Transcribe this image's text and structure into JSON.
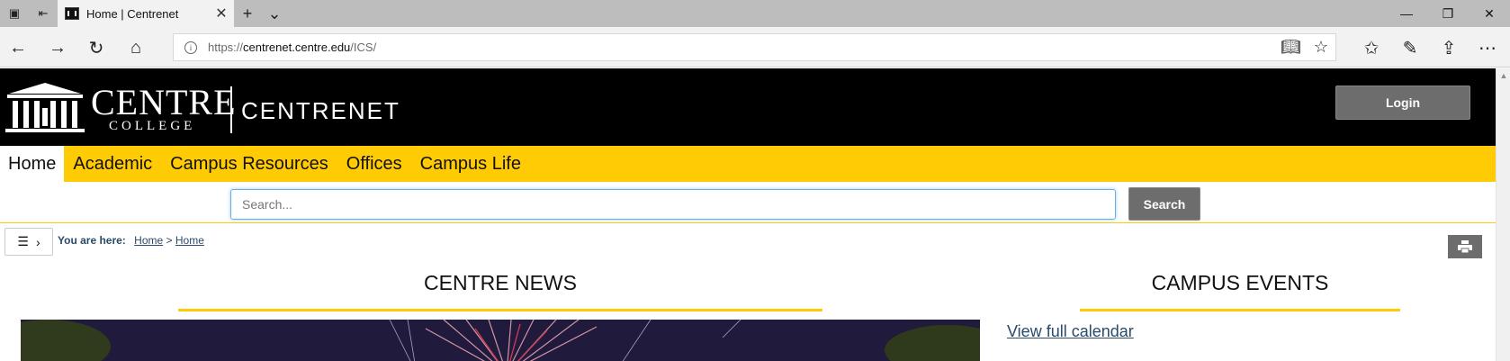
{
  "browser": {
    "tab_title": "Home | Centrenet",
    "url_scheme": "https://",
    "url_host": "centrenet.centre.edu",
    "url_path": "/ICS/"
  },
  "header": {
    "logo_wordmark": "CENTRE",
    "logo_subword": "COLLEGE",
    "site_name": "CENTRENET",
    "login_label": "Login"
  },
  "nav": {
    "items": [
      {
        "label": "Home",
        "active": true
      },
      {
        "label": "Academic"
      },
      {
        "label": "Campus Resources"
      },
      {
        "label": "Offices"
      },
      {
        "label": "Campus Life"
      }
    ]
  },
  "search": {
    "placeholder": "Search...",
    "button_label": "Search"
  },
  "breadcrumb": {
    "label": "You are here:",
    "items": [
      "Home",
      "Home"
    ],
    "separator": ">"
  },
  "news": {
    "title": "CENTRE NEWS"
  },
  "events": {
    "title": "CAMPUS EVENTS",
    "calendar_link": "View full calendar"
  },
  "colors": {
    "accent": "#ffcb05",
    "header_bg": "#000000",
    "button_bg": "#6d6d6d",
    "link": "#2a4a6b"
  },
  "icons": [
    "tab-list-icon",
    "set-aside-icon",
    "favicon-icon",
    "close-icon",
    "new-tab-icon",
    "chevron-down-icon",
    "minimize-icon",
    "restore-icon",
    "close-window-icon",
    "back-icon",
    "forward-icon",
    "refresh-icon",
    "home-icon",
    "info-icon",
    "reading-view-icon",
    "favorite-star-icon",
    "favorites-icon",
    "notes-icon",
    "share-icon",
    "more-icon",
    "hamburger-icon",
    "chevron-right-icon",
    "print-icon"
  ]
}
